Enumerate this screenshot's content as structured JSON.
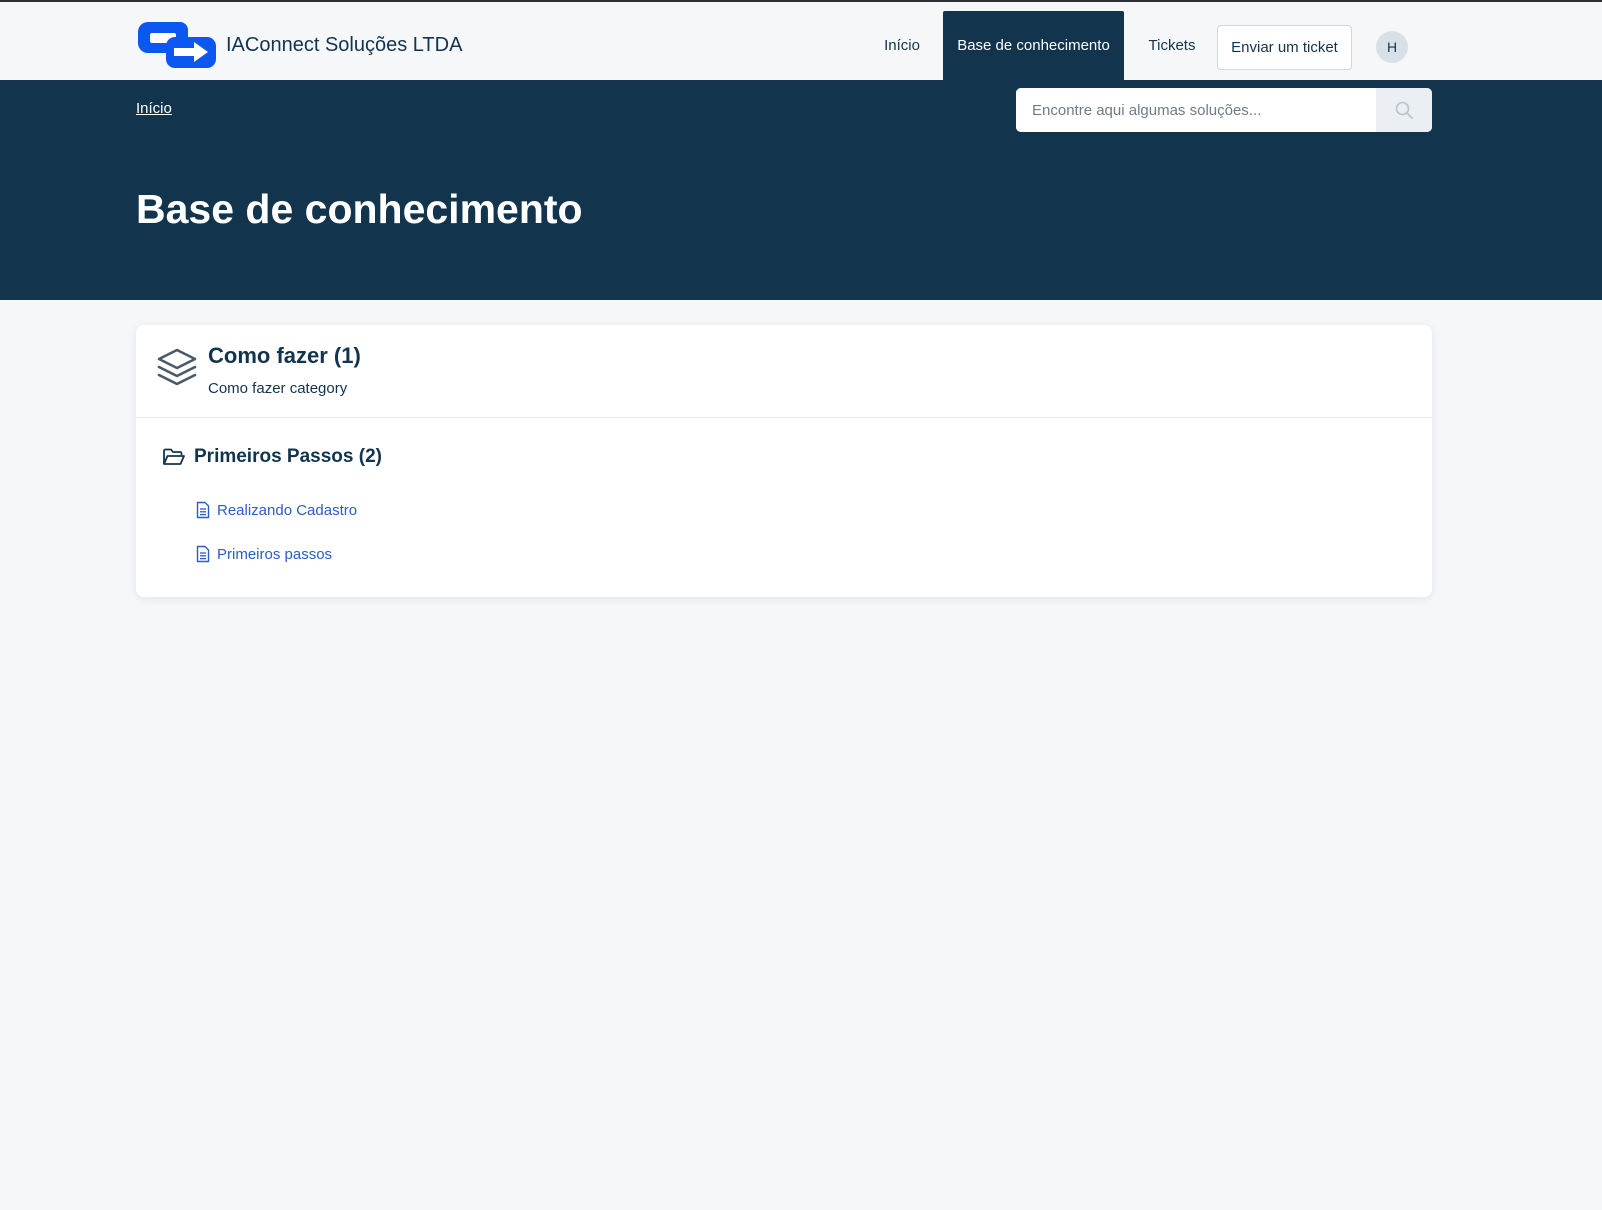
{
  "brand": {
    "name": "IAConnect Soluções LTDA",
    "logo_icon": "arrow-connect-logo",
    "logo_color": "#0b57f0"
  },
  "nav": {
    "home": "Início",
    "knowledge_base": "Base de conhecimento",
    "tickets": "Tickets",
    "submit_ticket": "Enviar um ticket",
    "avatar_initial": "H"
  },
  "hero": {
    "breadcrumb": "Início",
    "search_placeholder": "Encontre aqui algumas soluções...",
    "search_icon": "search-icon",
    "title": "Base de conhecimento"
  },
  "category": {
    "icon": "layers-icon",
    "title": "Como fazer (1)",
    "description": "Como fazer category",
    "folder": {
      "icon": "folder-open-icon",
      "title": "Primeiros Passos (2)",
      "articles": [
        {
          "label": "Realizando Cadastro",
          "icon": "document-icon"
        },
        {
          "label": "Primeiros passos",
          "icon": "document-icon"
        }
      ]
    }
  },
  "colors": {
    "primary": "#12344d",
    "link": "#2c5cc5",
    "background": "#f5f7f9"
  }
}
